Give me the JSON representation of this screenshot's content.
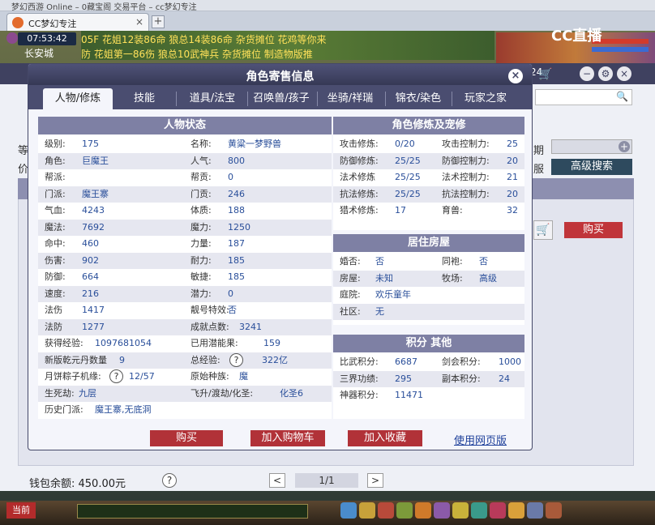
{
  "browser": {
    "window_title": "梦幻西游 Online – 0藏宝阁 交易平台 – cc梦幻专注",
    "tab_label": "CC梦幻专注",
    "tab_close": "×",
    "new_tab": "+"
  },
  "game_hud": {
    "clock": "07:53:42",
    "city": "长安城",
    "ticker_row1": "05F 花姐12装86命 狼总14装86命 杂货摊位 花鸡等你来",
    "ticker_row2": "防 花姐第一86伤 狼总10武神兵 杂货摊位 制造物版推",
    "logo": "CC直播",
    "count_badge": "24"
  },
  "bg_page": {
    "left_label1": "等",
    "left_label2": "价",
    "right_label1": "期",
    "right_label2": "服",
    "advanced_search": "高级搜索",
    "buy_button": "购买",
    "wallet_label": "钱包余额: 450.00元",
    "help": "?",
    "pager_prev": "<",
    "pager_text": "1/1",
    "pager_next": ">",
    "search_icon": "search-icon"
  },
  "taskbar": {
    "current_channel": "当前"
  },
  "modal": {
    "title": "角色寄售信息",
    "close": "×",
    "tabs": [
      {
        "label": "人物/修炼",
        "active": true
      },
      {
        "label": "技能"
      },
      {
        "label": "道具/法宝"
      },
      {
        "label": "召唤兽/孩子"
      },
      {
        "label": "坐骑/祥瑞"
      },
      {
        "label": "锦衣/染色"
      },
      {
        "label": "玩家之家"
      }
    ],
    "status": {
      "header": "人物状态",
      "left": [
        {
          "label": "级别:",
          "value": "175"
        },
        {
          "label": "角色:",
          "value": "巨魔王"
        },
        {
          "label": "帮派:",
          "value": ""
        },
        {
          "label": "门派:",
          "value": "魔王寨"
        },
        {
          "label": "气血:",
          "value": "4243"
        },
        {
          "label": "魔法:",
          "value": "7692"
        },
        {
          "label": "命中:",
          "value": "460"
        },
        {
          "label": "伤害:",
          "value": "902"
        },
        {
          "label": "防御:",
          "value": "664"
        },
        {
          "label": "速度:",
          "value": "216"
        },
        {
          "label": "法伤",
          "value": "1417"
        },
        {
          "label": "法防",
          "value": "1277"
        },
        {
          "label": "获得经验:",
          "value": "1097681054"
        },
        {
          "label": "新版乾元丹数量",
          "value": "9"
        },
        {
          "label": "月饼粽子机缘:",
          "value": "12/57"
        },
        {
          "label": "生死劫:",
          "value": "九层"
        },
        {
          "label": "历史门派:",
          "value": "魔王寨,无底洞"
        }
      ],
      "right": [
        {
          "label": "名称:",
          "value": "黄粱一梦野兽"
        },
        {
          "label": "人气:",
          "value": "800"
        },
        {
          "label": "帮贡:",
          "value": "0"
        },
        {
          "label": "门贡:",
          "value": "246"
        },
        {
          "label": "体质:",
          "value": "188"
        },
        {
          "label": "魔力:",
          "value": "1250"
        },
        {
          "label": "力量:",
          "value": "187"
        },
        {
          "label": "耐力:",
          "value": "185"
        },
        {
          "label": "敏捷:",
          "value": "185"
        },
        {
          "label": "潜力:",
          "value": "0"
        },
        {
          "label": "靓号特效:",
          "value": "否"
        },
        {
          "label": "成就点数:",
          "value": "3241"
        },
        {
          "label": "已用潜能果:",
          "value": "159"
        },
        {
          "label": "总经验:",
          "value": "322亿"
        },
        {
          "label": "原始种族:",
          "value": "魔"
        },
        {
          "label": "飞升/渡劫/化圣:",
          "value": "化圣6"
        }
      ]
    },
    "cultivation": {
      "header": "角色修炼及宠修",
      "rows": [
        {
          "l1": "攻击修炼:",
          "v1": "0/20",
          "l2": "攻击控制力:",
          "v2": "25"
        },
        {
          "l1": "防御修炼:",
          "v1": "25/25",
          "l2": "防御控制力:",
          "v2": "20"
        },
        {
          "l1": "法术修炼",
          "v1": "25/25",
          "l2": "法术控制力:",
          "v2": "21"
        },
        {
          "l1": "抗法修炼:",
          "v1": "25/25",
          "l2": "抗法控制力:",
          "v2": "20"
        },
        {
          "l1": "猎术修炼:",
          "v1": "17",
          "l2": "育兽:",
          "v2": "32"
        }
      ]
    },
    "housing": {
      "header": "居住房屋",
      "rows": [
        {
          "l1": "婚否:",
          "v1": "否",
          "l2": "同袍:",
          "v2": "否"
        },
        {
          "l1": "房屋:",
          "v1": "未知",
          "l2": "牧场:",
          "v2": "高级"
        },
        {
          "l1": "庭院:",
          "v1": "欢乐童年"
        },
        {
          "l1": "社区:",
          "v1": "无"
        }
      ]
    },
    "points": {
      "header": "积分 其他",
      "rows": [
        {
          "l1": "比武积分:",
          "v1": "6687",
          "l2": "剑会积分:",
          "v2": "1000"
        },
        {
          "l1": "三界功绩:",
          "v1": "295",
          "l2": "副本积分:",
          "v2": "24"
        },
        {
          "l1": "神器积分:",
          "v1": "11471"
        }
      ]
    },
    "help": "?",
    "buttons": {
      "buy": "购买",
      "add_cart": "加入购物车",
      "add_fav": "加入收藏",
      "web_link": "使用网页版"
    }
  },
  "colors": {
    "modal_header": "#454868",
    "section_header": "#7e80a4",
    "value_blue": "#2a4f9a",
    "buy_red": "#b13238"
  }
}
